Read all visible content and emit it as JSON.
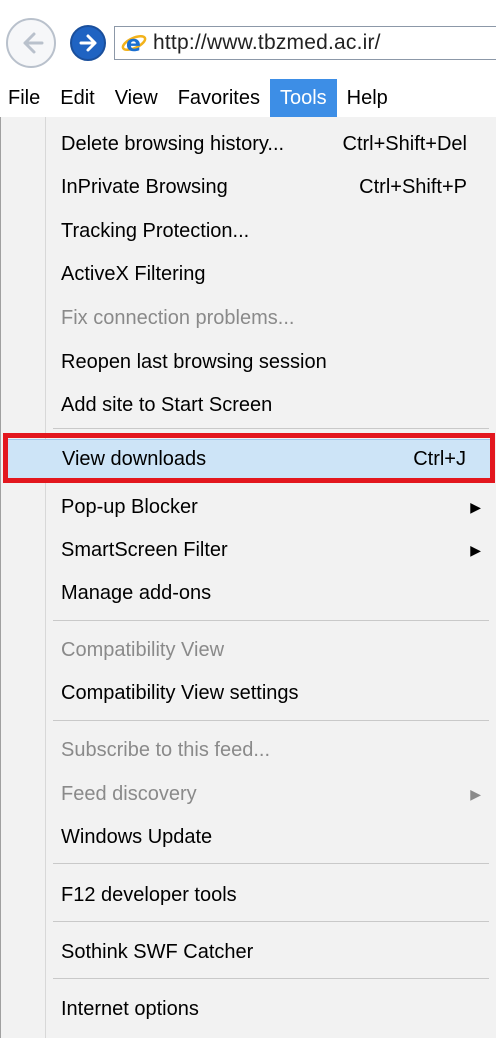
{
  "browser": {
    "url_text": "http://www.tbzmed.ac.ir/",
    "back_icon": "back-arrow-icon",
    "forward_icon": "forward-arrow-icon",
    "site_icon": "ie-logo-icon"
  },
  "menu_bar": {
    "items": [
      "File",
      "Edit",
      "View",
      "Favorites",
      "Tools",
      "Help"
    ],
    "active": "Tools"
  },
  "tools_menu": {
    "delete_history": {
      "label": "Delete browsing history...",
      "shortcut": "Ctrl+Shift+Del"
    },
    "inprivate": {
      "label": "InPrivate Browsing",
      "shortcut": "Ctrl+Shift+P"
    },
    "tracking": {
      "label": "Tracking Protection..."
    },
    "activex": {
      "label": "ActiveX Filtering"
    },
    "fix_connection": {
      "label": "Fix connection problems...",
      "disabled": true
    },
    "reopen_session": {
      "label": "Reopen last browsing session"
    },
    "add_site": {
      "label": "Add site to Start Screen"
    },
    "view_downloads": {
      "label": "View downloads",
      "shortcut": "Ctrl+J",
      "highlighted": true
    },
    "popup_blocker": {
      "label": "Pop-up Blocker",
      "submenu": true
    },
    "smartscreen": {
      "label": "SmartScreen Filter",
      "submenu": true
    },
    "manage_addons": {
      "label": "Manage add-ons"
    },
    "compat_view": {
      "label": "Compatibility View",
      "disabled": true
    },
    "compat_settings": {
      "label": "Compatibility View settings"
    },
    "subscribe_feed": {
      "label": "Subscribe to this feed...",
      "disabled": true
    },
    "feed_discovery": {
      "label": "Feed discovery",
      "disabled": true,
      "submenu": true
    },
    "windows_update": {
      "label": "Windows Update"
    },
    "f12_tools": {
      "label": "F12 developer tools"
    },
    "swf_catcher": {
      "label": "Sothink SWF Catcher"
    },
    "internet_options": {
      "label": "Internet options"
    }
  },
  "colors": {
    "active_menu": "#3d8ee6",
    "highlight": "#cde4f7",
    "annotation_frame": "#e3171e",
    "disabled_text": "#8a8a8a"
  }
}
